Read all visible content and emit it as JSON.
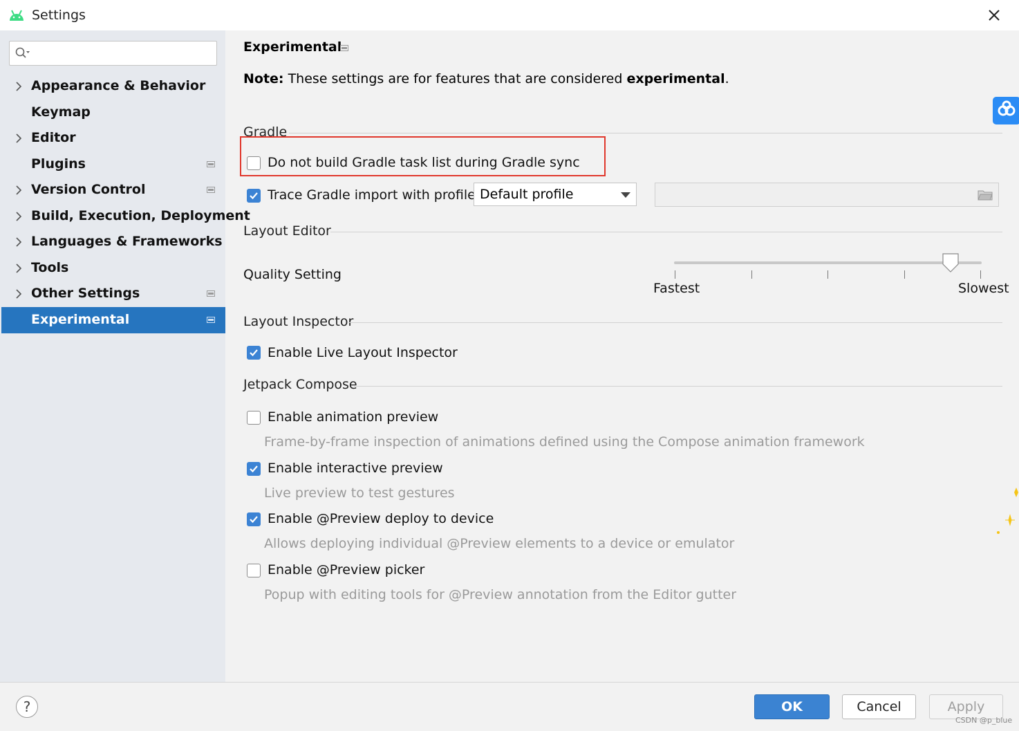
{
  "window": {
    "title": "Settings",
    "close_icon": "close-icon"
  },
  "sidebar": {
    "search": {
      "value": "",
      "placeholder": ""
    },
    "items": [
      {
        "label": "Appearance & Behavior",
        "expandable": true,
        "project_icon": false
      },
      {
        "label": "Keymap",
        "expandable": false,
        "project_icon": false
      },
      {
        "label": "Editor",
        "expandable": true,
        "project_icon": false
      },
      {
        "label": "Plugins",
        "expandable": false,
        "project_icon": true
      },
      {
        "label": "Version Control",
        "expandable": true,
        "project_icon": true
      },
      {
        "label": "Build, Execution, Deployment",
        "expandable": true,
        "project_icon": false
      },
      {
        "label": "Languages & Frameworks",
        "expandable": true,
        "project_icon": false
      },
      {
        "label": "Tools",
        "expandable": true,
        "project_icon": false
      },
      {
        "label": "Other Settings",
        "expandable": true,
        "project_icon": true
      },
      {
        "label": "Experimental",
        "expandable": false,
        "project_icon": true,
        "selected": true
      }
    ]
  },
  "main": {
    "title": "Experimental",
    "note": {
      "prefix": "Note:",
      "text": " These settings are for features that are considered ",
      "bold": "experimental",
      "suffix": "."
    },
    "gradle": {
      "section": "Gradle",
      "no_task_list": {
        "label": "Do not build Gradle task list during Gradle sync",
        "checked": false
      },
      "trace_import": {
        "label": "Trace Gradle import with profile:",
        "checked": true
      },
      "profile_select": {
        "value": "Default profile"
      },
      "profile_path": {
        "value": ""
      }
    },
    "layout_editor": {
      "section": "Layout Editor",
      "quality_label": "Quality Setting",
      "slider": {
        "min_label": "Fastest",
        "max_label": "Slowest",
        "steps": 5,
        "value_step": 5
      }
    },
    "layout_inspector": {
      "section": "Layout Inspector",
      "live": {
        "label": "Enable Live Layout Inspector",
        "checked": true
      }
    },
    "compose": {
      "section": "Jetpack Compose",
      "options": [
        {
          "label": "Enable animation preview",
          "checked": false,
          "desc": "Frame-by-frame inspection of animations defined using the Compose animation framework"
        },
        {
          "label": "Enable interactive preview",
          "checked": true,
          "desc": "Live preview to test gestures"
        },
        {
          "label": "Enable @Preview deploy to device",
          "checked": true,
          "desc": "Allows deploying individual @Preview elements to a device or emulator"
        },
        {
          "label": "Enable @Preview picker",
          "checked": false,
          "desc": "Popup with editing tools for @Preview annotation from the Editor gutter"
        }
      ]
    }
  },
  "footer": {
    "help": "?",
    "ok": "OK",
    "cancel": "Cancel",
    "apply": "Apply"
  },
  "watermark": "CSDN @p_blue",
  "colors": {
    "selection": "#2675bf",
    "checkbox_on": "#3c83d4",
    "highlight": "#e0372c",
    "ok_button": "#3b83d2"
  }
}
